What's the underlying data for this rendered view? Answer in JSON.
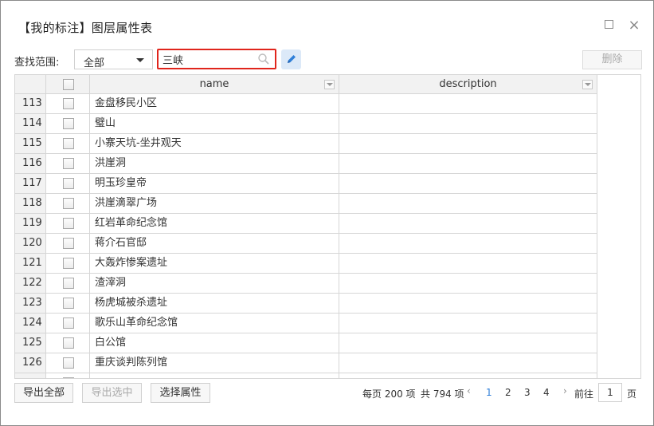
{
  "dialog": {
    "title": "【我的标注】图层属性表"
  },
  "toolbar": {
    "range_label": "查找范围:",
    "range_value": "全部",
    "search_value": "三峡",
    "delete_label": "删除"
  },
  "table": {
    "columns": [
      "name",
      "description"
    ],
    "rows": [
      {
        "num": "113",
        "name": "金盘移民小区",
        "description": ""
      },
      {
        "num": "114",
        "name": "璧山",
        "description": ""
      },
      {
        "num": "115",
        "name": "小寨天坑-坐井观天",
        "description": ""
      },
      {
        "num": "116",
        "name": "洪崖洞",
        "description": ""
      },
      {
        "num": "117",
        "name": "明玉珍皇帝",
        "description": ""
      },
      {
        "num": "118",
        "name": "洪崖滴翠广场",
        "description": ""
      },
      {
        "num": "119",
        "name": "红岩革命纪念馆",
        "description": ""
      },
      {
        "num": "120",
        "name": "蒋介石官邸",
        "description": ""
      },
      {
        "num": "121",
        "name": "大轰炸惨案遗址",
        "description": ""
      },
      {
        "num": "122",
        "name": "渣滓洞",
        "description": ""
      },
      {
        "num": "123",
        "name": "杨虎城被杀遗址",
        "description": ""
      },
      {
        "num": "124",
        "name": "歌乐山革命纪念馆",
        "description": ""
      },
      {
        "num": "125",
        "name": "白公馆",
        "description": ""
      },
      {
        "num": "126",
        "name": "重庆谈判陈列馆",
        "description": ""
      }
    ]
  },
  "footer": {
    "export_all": "导出全部",
    "export_selected": "导出选中",
    "select_attr": "选择属性"
  },
  "pagination": {
    "per_page": "每页 200 项",
    "total": "共 794 项",
    "pages": [
      "1",
      "2",
      "3",
      "4"
    ],
    "goto_label": "前往",
    "goto_value": "1",
    "page_unit": "页"
  }
}
